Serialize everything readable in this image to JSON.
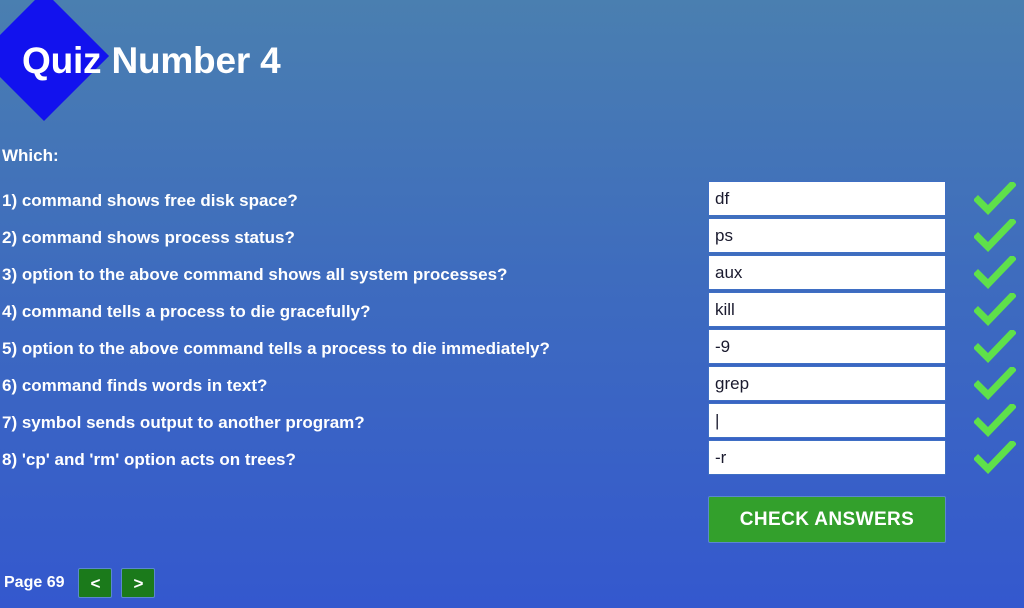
{
  "header": {
    "title": "Quiz Number 4",
    "diamond_color": "#1212EE"
  },
  "body": {
    "prompt": "Which:",
    "questions": [
      {
        "text": "1) command shows free disk space?"
      },
      {
        "text": "2) command shows process status?"
      },
      {
        "text": "3) option to the above command shows all system processes?"
      },
      {
        "text": "4) command tells a process to die gracefully?"
      },
      {
        "text": "5) option to the above command tells a process to die immediately?"
      },
      {
        "text": "6) command finds words in text?"
      },
      {
        "text": "7) symbol sends output to another program?"
      },
      {
        "text": "8) 'cp' and 'rm' option acts on trees?"
      }
    ],
    "answers": [
      {
        "value": "df",
        "placeholder": "",
        "correct": true
      },
      {
        "value": "ps",
        "placeholder": "",
        "correct": true
      },
      {
        "value": "aux",
        "placeholder": "",
        "correct": true
      },
      {
        "value": "kill",
        "placeholder": "",
        "correct": true
      },
      {
        "value": "-9",
        "placeholder": "",
        "correct": true
      },
      {
        "value": "grep",
        "placeholder": "",
        "correct": true
      },
      {
        "value": "|",
        "placeholder": "",
        "correct": true
      },
      {
        "value": "-r",
        "placeholder": "",
        "correct": true
      }
    ]
  },
  "actions": {
    "check_answers_label": "CHECK ANSWERS"
  },
  "footer": {
    "page_label": "Page 69",
    "prev_label": "<",
    "next_label": ">"
  },
  "colors": {
    "background_top": "#4A7FB0",
    "background_bottom": "#3458CE",
    "check_mark": "#5FE04A",
    "button_green": "#33A02C",
    "nav_green": "#1B7A1B"
  }
}
